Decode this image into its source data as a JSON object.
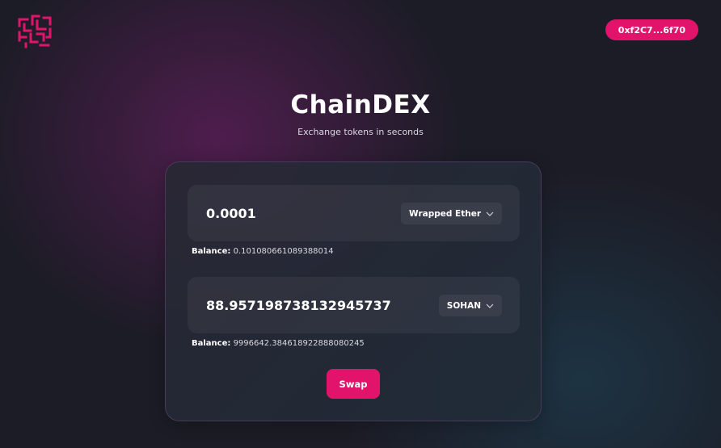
{
  "header": {
    "wallet_address": "0xf2C7...6f70"
  },
  "hero": {
    "title": "ChainDEX",
    "subtitle": "Exchange tokens in seconds"
  },
  "swap": {
    "from": {
      "amount": "0.0001",
      "token": "Wrapped Ether",
      "balance_label": "Balance:",
      "balance_value": "0.101080661089388014"
    },
    "to": {
      "amount": "88.957198738132945737",
      "token": "SOHAN",
      "balance_label": "Balance:",
      "balance_value": "9996642.384618922888080245"
    },
    "button_label": "Swap"
  },
  "colors": {
    "accent": "#e2136b",
    "background": "#1c1c26",
    "token_select_bg": "#3a3d4a"
  },
  "icons": {
    "logo": "maze-logo-icon",
    "dropdown": "chevron-down-icon"
  }
}
